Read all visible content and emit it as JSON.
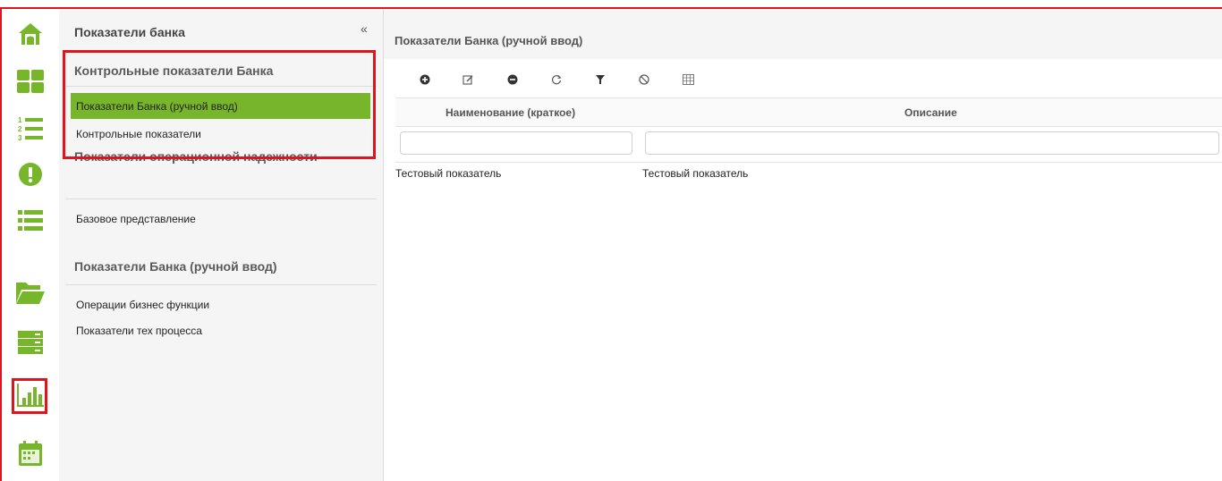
{
  "sidebar": {
    "title": "Показатели банка",
    "collapse_glyph": "«",
    "groups": [
      {
        "title": "Контрольные показатели Банка",
        "items": [
          "Показатели Банка (ручной ввод)",
          "Контрольные показатели"
        ]
      },
      {
        "title": "Показатели операционной надежности",
        "items": [
          "Базовое представление"
        ]
      },
      {
        "title": "Показатели Банка (ручной ввод)",
        "items": [
          "Операции бизнес функции",
          "Показатели тех процесса"
        ]
      }
    ],
    "selected_item": "Показатели Банка (ручной ввод)"
  },
  "rail": {
    "icons": [
      "home-icon",
      "dashboard-grid-icon",
      "numbered-list-icon",
      "alert-icon",
      "list-icon",
      "folder-icon",
      "server-icon",
      "bar-chart-icon",
      "calendar-icon"
    ],
    "active": "bar-chart-icon"
  },
  "main": {
    "title": "Показатели Банка (ручной ввод)",
    "toolbar": [
      "add-icon",
      "edit-icon",
      "remove-icon",
      "refresh-icon",
      "filter-icon",
      "clear-filter-icon",
      "columns-icon"
    ],
    "columns": [
      "Наименование (краткое)",
      "Описание"
    ],
    "filters": [
      "",
      ""
    ],
    "rows": [
      [
        "Тестовый показатель",
        "Тестовый показатель"
      ]
    ]
  },
  "colors": {
    "accent_green": "#77b62a",
    "highlight_red": "#e0141e"
  }
}
